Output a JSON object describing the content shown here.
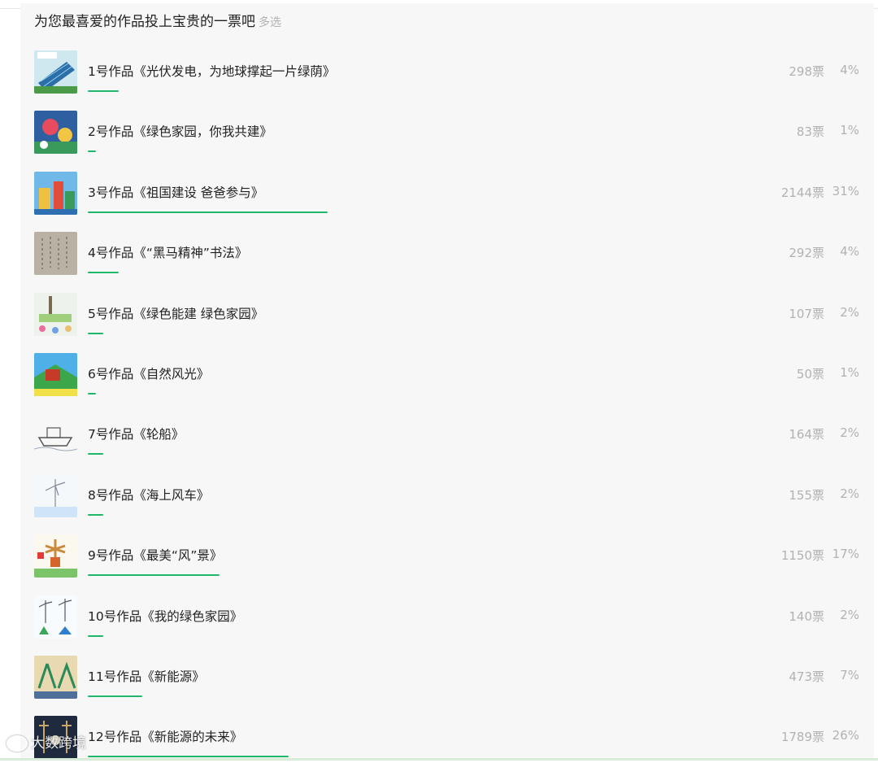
{
  "poll": {
    "title": "为您最喜爱的作品投上宝贵的一票吧",
    "mode": "多选",
    "accent_color": "#1fb86a",
    "options": [
      {
        "label": "1号作品《光伏发电，为地球撑起一片绿荫》",
        "votes": "298票",
        "percent": "4%",
        "share": 0.04
      },
      {
        "label": "2号作品《绿色家园，你我共建》",
        "votes": "83票",
        "percent": "1%",
        "share": 0.01
      },
      {
        "label": "3号作品《祖国建设 爸爸参与》",
        "votes": "2144票",
        "percent": "31%",
        "share": 0.31
      },
      {
        "label": "4号作品《“黑马精神”书法》",
        "votes": "292票",
        "percent": "4%",
        "share": 0.04
      },
      {
        "label": "5号作品《绿色能建 绿色家园》",
        "votes": "107票",
        "percent": "2%",
        "share": 0.02
      },
      {
        "label": "6号作品《自然风光》",
        "votes": "50票",
        "percent": "1%",
        "share": 0.01
      },
      {
        "label": "7号作品《轮船》",
        "votes": "164票",
        "percent": "2%",
        "share": 0.02
      },
      {
        "label": "8号作品《海上风车》",
        "votes": "155票",
        "percent": "2%",
        "share": 0.02
      },
      {
        "label": "9号作品《最美“风”景》",
        "votes": "1150票",
        "percent": "17%",
        "share": 0.17
      },
      {
        "label": "10号作品《我的绿色家园》",
        "votes": "140票",
        "percent": "2%",
        "share": 0.02
      },
      {
        "label": "11号作品《新能源》",
        "votes": "473票",
        "percent": "7%",
        "share": 0.07
      },
      {
        "label": "12号作品《新能源的未来》",
        "votes": "1789票",
        "percent": "26%",
        "share": 0.26
      }
    ]
  },
  "watermark": {
    "text": "大数跨境"
  }
}
